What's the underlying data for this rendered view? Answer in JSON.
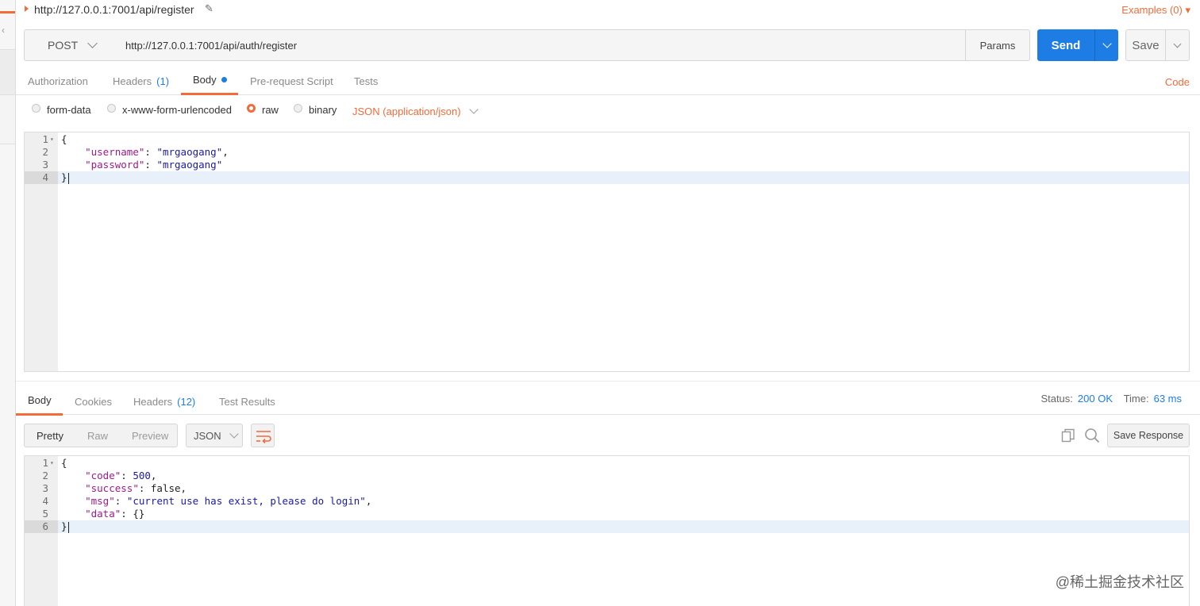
{
  "request": {
    "title": "http://127.0.0.1:7001/api/register",
    "examples_label": "Examples (0) ▾",
    "method": "POST",
    "url": "http://127.0.0.1:7001/api/auth/register",
    "params_label": "Params",
    "send_label": "Send",
    "save_label": "Save",
    "code_label": "Code",
    "tabs": [
      {
        "label": "Authorization"
      },
      {
        "label": "Headers",
        "count": "(1)"
      },
      {
        "label": "Body"
      },
      {
        "label": "Pre-request Script"
      },
      {
        "label": "Tests"
      }
    ],
    "body_types": [
      "form-data",
      "x-www-form-urlencoded",
      "raw",
      "binary"
    ],
    "content_type": "JSON (application/json)"
  },
  "request_body_lines": [
    {
      "n": "1",
      "text": "{"
    },
    {
      "n": "2",
      "key": "\"username\"",
      "value": "\"mrgaogang\"",
      "tail": ","
    },
    {
      "n": "3",
      "key": "\"password\"",
      "value": "\"mrgaogang\"",
      "tail": ""
    },
    {
      "n": "4",
      "text": "}"
    }
  ],
  "response": {
    "tabs": [
      {
        "label": "Body"
      },
      {
        "label": "Cookies"
      },
      {
        "label": "Headers",
        "count": "(12)"
      },
      {
        "label": "Test Results"
      }
    ],
    "status_label": "Status:",
    "status_value": "200 OK",
    "time_label": "Time:",
    "time_value": "63 ms",
    "views": [
      "Pretty",
      "Raw",
      "Preview"
    ],
    "format": "JSON",
    "save_response_label": "Save Response"
  },
  "response_body_lines": [
    {
      "n": "1",
      "text": "{"
    },
    {
      "n": "2",
      "key": "\"code\"",
      "value": "500",
      "tail": ","
    },
    {
      "n": "3",
      "key": "\"success\"",
      "value": "false",
      "tail": ","
    },
    {
      "n": "4",
      "key": "\"msg\"",
      "value": "\"current use has exist, please do login\"",
      "tail": ","
    },
    {
      "n": "5",
      "key": "\"data\"",
      "value": "{}",
      "tail": ""
    },
    {
      "n": "6",
      "text": "}"
    }
  ],
  "watermark": "@稀土掘金技术社区",
  "colors": {
    "accent": "#f26b3a",
    "primary": "#1d7de4"
  }
}
